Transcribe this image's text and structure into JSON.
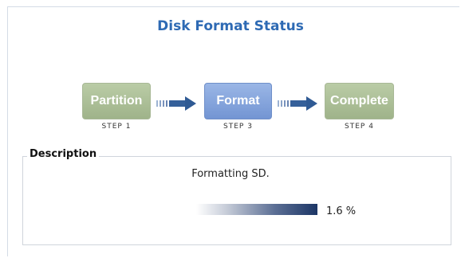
{
  "header": {
    "title": "Disk Format Status"
  },
  "steps": [
    {
      "label": "Partition",
      "caption": "STEP 1",
      "state": "done"
    },
    {
      "label": "Format",
      "caption": "STEP 3",
      "state": "active"
    },
    {
      "label": "Complete",
      "caption": "STEP 4",
      "state": "done"
    }
  ],
  "description": {
    "legend": "Description",
    "message": "Formatting SD.",
    "progress_text": "1.6 %",
    "progress_percent": 1.6
  },
  "colors": {
    "title": "#2e6ab4",
    "step_done": "#a6b890",
    "step_active": "#7f9fdb",
    "arrow": "#2f5a94",
    "progress_dark": "#1c3666"
  },
  "icons": [
    "right-arrow-icon",
    "right-arrow-icon"
  ]
}
